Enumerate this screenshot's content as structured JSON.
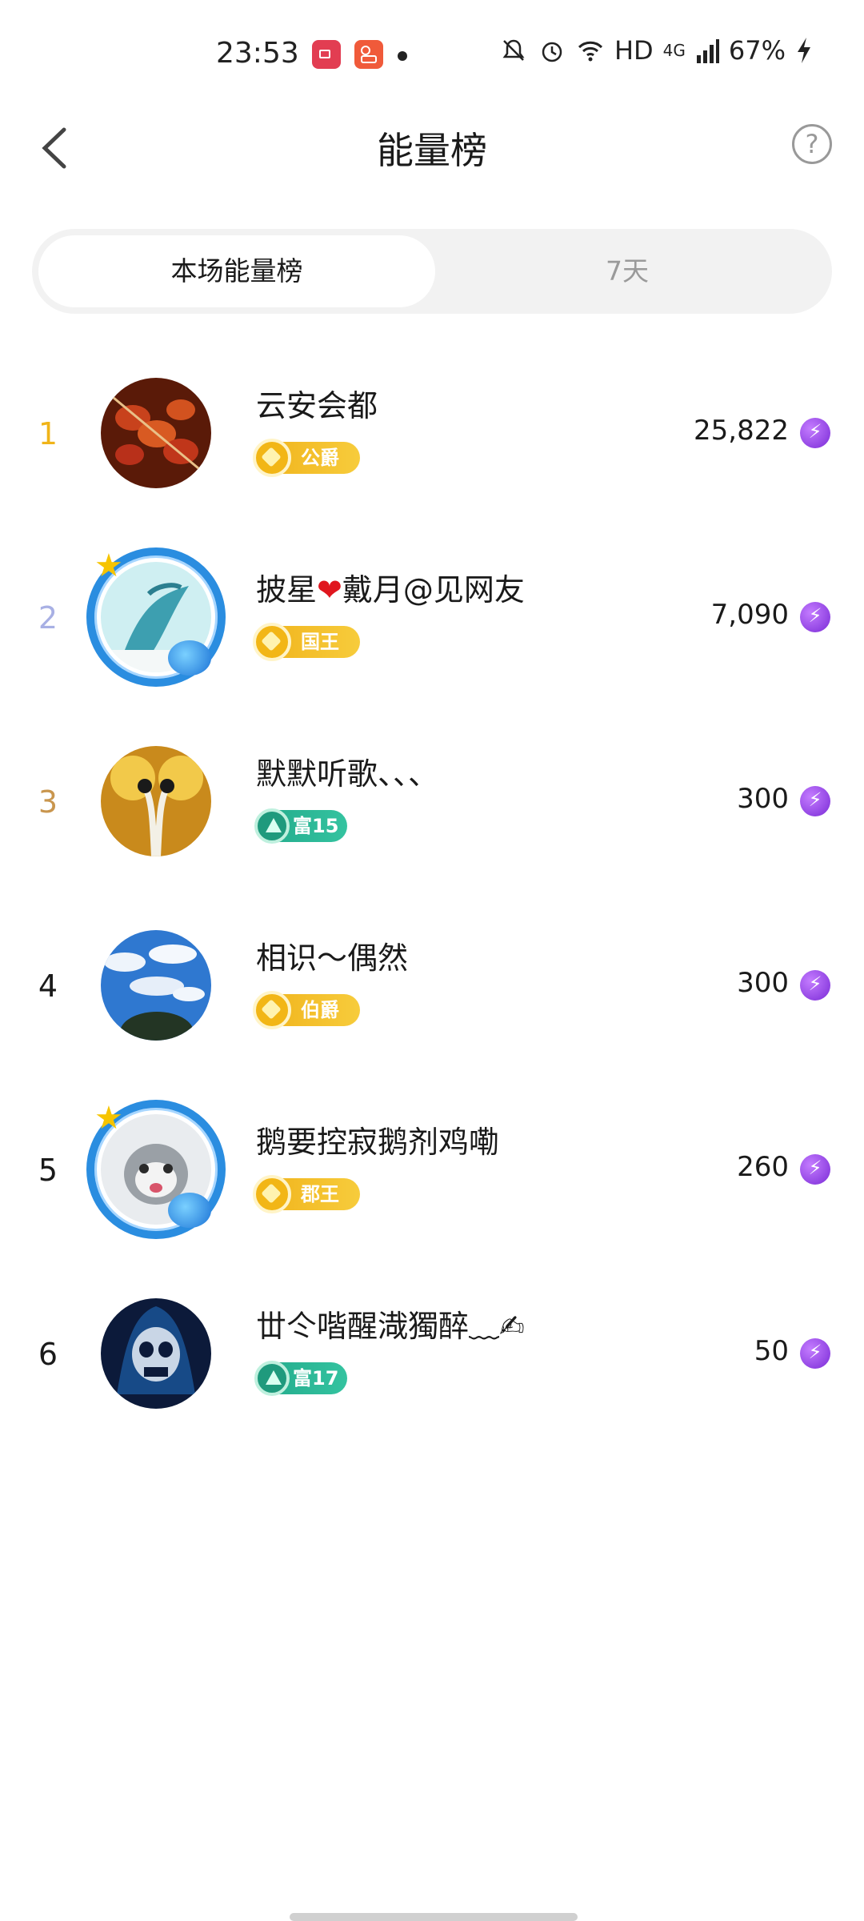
{
  "status_bar": {
    "time": "23:53",
    "network": "HD",
    "signal": "4G",
    "battery": "67%"
  },
  "header": {
    "title": "能量榜",
    "help_label": "?"
  },
  "tabs": [
    {
      "label": "本场能量榜",
      "active": true
    },
    {
      "label": "7天",
      "active": false
    }
  ],
  "colors": {
    "rank1": "#f0b419",
    "rank2": "#a8b0e4",
    "rank3": "#c9964e",
    "rank_default": "#1a1a1a",
    "badge_gold": "#f2b616",
    "badge_green": "#22a98a",
    "energy_purple": "#8a35e0"
  },
  "rows": [
    {
      "rank": "1",
      "name": "云安会都",
      "badge": "公爵",
      "badge_type": "gold",
      "score": "25,822"
    },
    {
      "rank": "2",
      "name_a": "披星",
      "name_heart": "❤",
      "name_b": "戴月@见网友",
      "badge": "国王",
      "badge_type": "gold",
      "score": "7,090"
    },
    {
      "rank": "3",
      "name": "默默听歌、、、",
      "badge": "富15",
      "badge_type": "green",
      "score": "300"
    },
    {
      "rank": "4",
      "name": "相识～偶然",
      "badge": "伯爵",
      "badge_type": "gold",
      "score": "300"
    },
    {
      "rank": "5",
      "name": "鹅要控寂鹅剂鸡嘞",
      "badge": "郡王",
      "badge_type": "gold",
      "score": "260"
    },
    {
      "rank": "6",
      "name": "丗仒喈醒渽獨醉﹏✍",
      "badge": "富17",
      "badge_type": "green",
      "score": "50"
    }
  ]
}
